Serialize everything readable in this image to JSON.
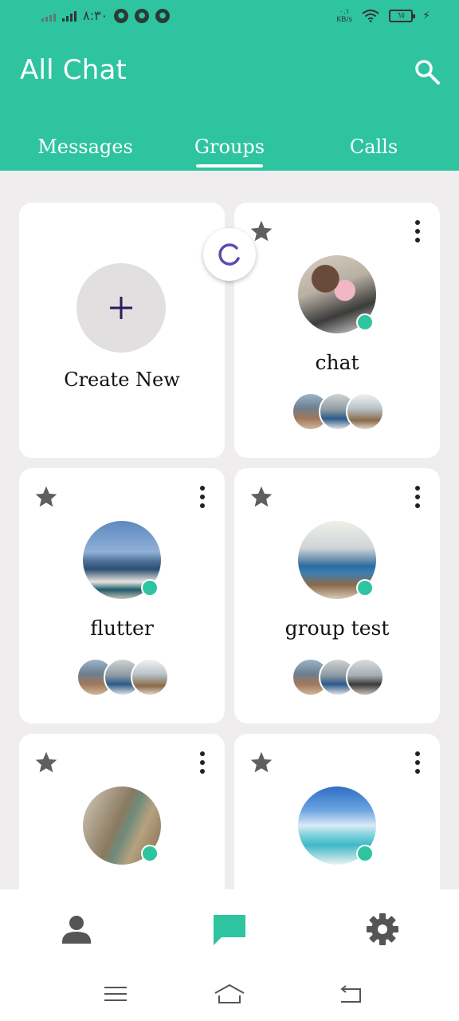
{
  "status_bar": {
    "time": "٨:٣٠",
    "net_speed_top": "٠.١",
    "net_speed_bottom": "KB/s",
    "battery": "٦٥"
  },
  "app": {
    "title": "All Chat"
  },
  "tabs": [
    {
      "label": "Messages",
      "selected": false
    },
    {
      "label": "Groups",
      "selected": true
    },
    {
      "label": "Calls",
      "selected": false
    }
  ],
  "create_card": {
    "label": "Create New",
    "icon": "plus-icon"
  },
  "groups": [
    {
      "name": "chat",
      "online": true,
      "member_count": 3
    },
    {
      "name": "flutter",
      "online": true,
      "member_count": 3
    },
    {
      "name": "group test",
      "online": true,
      "member_count": 3
    },
    {
      "name": "",
      "online": true,
      "member_count": 0
    },
    {
      "name": "",
      "online": true,
      "member_count": 0
    }
  ],
  "bottom_nav": [
    {
      "icon": "person-icon",
      "active": false
    },
    {
      "icon": "chat-bubble-icon",
      "active": true
    },
    {
      "icon": "gear-icon",
      "active": false
    }
  ],
  "colors": {
    "accent": "#2ec4a0",
    "background": "#efedee",
    "star": "#5f5f5f",
    "plus": "#2a1b5e",
    "spinner": "#5b4bb0"
  }
}
